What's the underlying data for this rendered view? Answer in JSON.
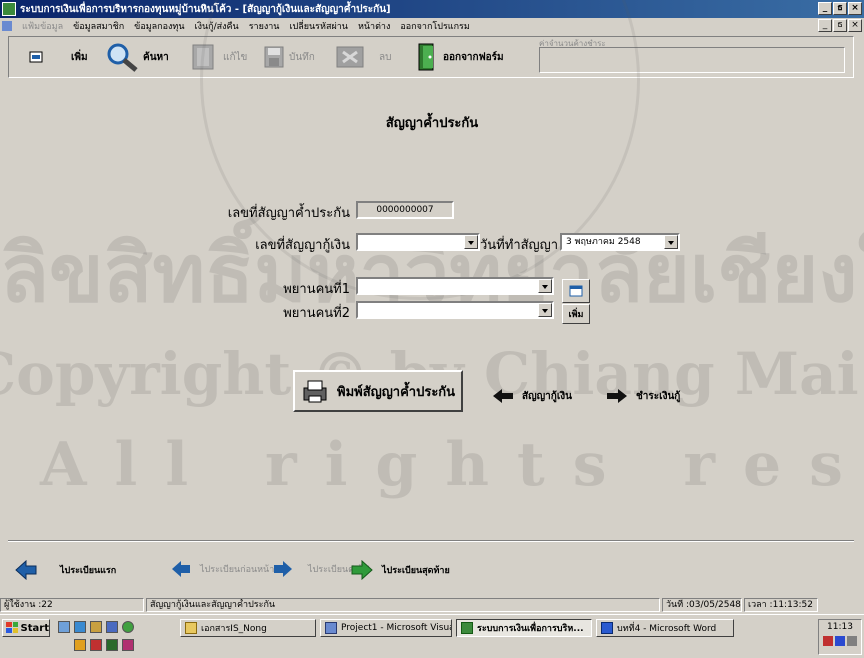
{
  "window": {
    "title": "ระบบการเงินเพื่อการบริหารกองทุนหมู่บ้านหินโค้ว - [สัญญากู้เงินและสัญญาค้ำประกัน]",
    "controls": [
      "_",
      "ธ",
      "×"
    ]
  },
  "menu": {
    "items": [
      "แฟ้มข้อมูล",
      "ข้อมูลสมาชิก",
      "ข้อมูลกองทุน",
      "เงินกู้/ส่งคืน",
      "รายงาน",
      "เปลี่ยนรหัสผ่าน",
      "หน้าต่าง",
      "ออกจากโปรแกรม"
    ],
    "disabled": [
      true,
      false,
      false,
      false,
      false,
      false,
      false,
      false
    ]
  },
  "toolbar": {
    "add_label": "เพิ่ม",
    "search_label": "ค้นหา",
    "edit_label": "แก้ไข",
    "save_label": "บันทึก",
    "delete_label": "ลบ",
    "exit_label": "ออกจากฟอร์ม",
    "status_label": "ค่าจำนวนค้างชำระ"
  },
  "form": {
    "heading": "สัญญาค้ำประกัน",
    "guarantee_no_label": "เลขที่สัญญาค้ำประกัน",
    "guarantee_no_value": "0000000007",
    "loan_no_label": "เลขที่สัญญากู้เงิน",
    "loan_no_value": "",
    "contract_date_label": "วันที่ทำสัญญา",
    "contract_date_value": "3  พฤษภาคม  2548",
    "witness1_label": "พยานคนที่1",
    "witness1_value": "",
    "witness2_label": "พยานคนที่2",
    "witness2_value": "",
    "add_witness_label": "เพิ่ม",
    "print_label": "พิมพ์สัญญาค้ำประกัน",
    "back_link_label": "สัญญากู้เงิน",
    "forward_link_label": "ชำระเงินกู้"
  },
  "watermark": {
    "line1": "ลิขสิทธิ์มหาวิทยาลัยเชียงใหม่",
    "line2": "Copyright © by Chiang Mai University",
    "line3": "All rights reserved",
    "seal_text": "MAI UNIVERSITY"
  },
  "record_nav": {
    "first": "ไประเบียนแรก",
    "prev": "ไประเบียนก่อนหน้า",
    "next": "ไประเบียนต่อไป",
    "last": "ไประเบียนสุดท้าย"
  },
  "statusbar": {
    "user": "ผู้ใช้งาน :22",
    "form_name": "สัญญากู้เงินและสัญญาค้ำประกัน",
    "date": "วันที่ :03/05/2548",
    "time": "เวลา :11:13:52"
  },
  "taskbar": {
    "start_label": "Start",
    "tasks": [
      {
        "label": "เอกสารIS_Nong",
        "active": false
      },
      {
        "label": "Project1 - Microsoft Visual...",
        "active": false
      },
      {
        "label": "ระบบการเงินเพื่อการบริห...",
        "active": true
      },
      {
        "label": "บทที่4 - Microsoft Word",
        "active": false
      }
    ],
    "clock": "11:13"
  },
  "colors": {
    "face": "#d4d0c8",
    "title_start": "#0a246a",
    "title_end": "#3a6ea5",
    "arrow_blue": "#1f5fa8",
    "arrow_green": "#2f9a3a"
  }
}
